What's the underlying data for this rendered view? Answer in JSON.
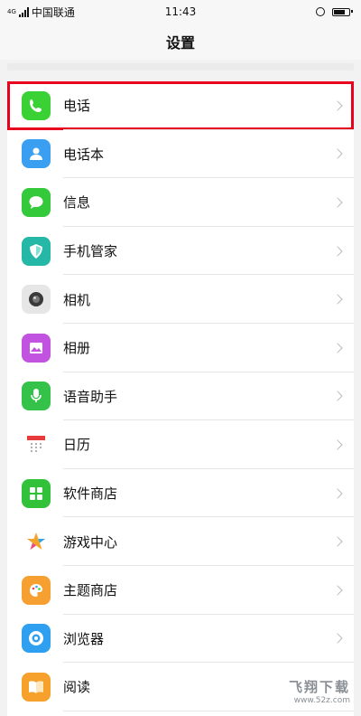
{
  "status_bar": {
    "carrier": "中国联通",
    "time": "11:43",
    "signal_label": "4G",
    "battery_level": 0.8
  },
  "header": {
    "title": "设置"
  },
  "settings": [
    {
      "label": "电话",
      "icon": "phone-icon",
      "color": "#3ad135",
      "highlighted": true
    },
    {
      "label": "电话本",
      "icon": "contacts-icon",
      "color": "#3a9ff0"
    },
    {
      "label": "信息",
      "icon": "message-icon",
      "color": "#34c93a"
    },
    {
      "label": "手机管家",
      "icon": "shield-icon",
      "color": "#25b8a6"
    },
    {
      "label": "相机",
      "icon": "camera-icon",
      "color": "#9ea3a8"
    },
    {
      "label": "相册",
      "icon": "gallery-icon",
      "color": "#c253e0"
    },
    {
      "label": "语音助手",
      "icon": "microphone-icon",
      "color": "#34c24a"
    },
    {
      "label": "日历",
      "icon": "calendar-icon",
      "color": "#e73a3a"
    },
    {
      "label": "软件商店",
      "icon": "app-store-icon",
      "color": "#32c23a"
    },
    {
      "label": "游戏中心",
      "icon": "game-center-icon",
      "color": "#f3a42a"
    },
    {
      "label": "主题商店",
      "icon": "theme-store-icon",
      "color": "#f5a031"
    },
    {
      "label": "浏览器",
      "icon": "browser-icon",
      "color": "#2f9ff0"
    },
    {
      "label": "阅读",
      "icon": "book-icon",
      "color": "#f5a12c"
    }
  ],
  "watermark": {
    "main": "飞翔下载",
    "sub": "www.52z.com"
  }
}
